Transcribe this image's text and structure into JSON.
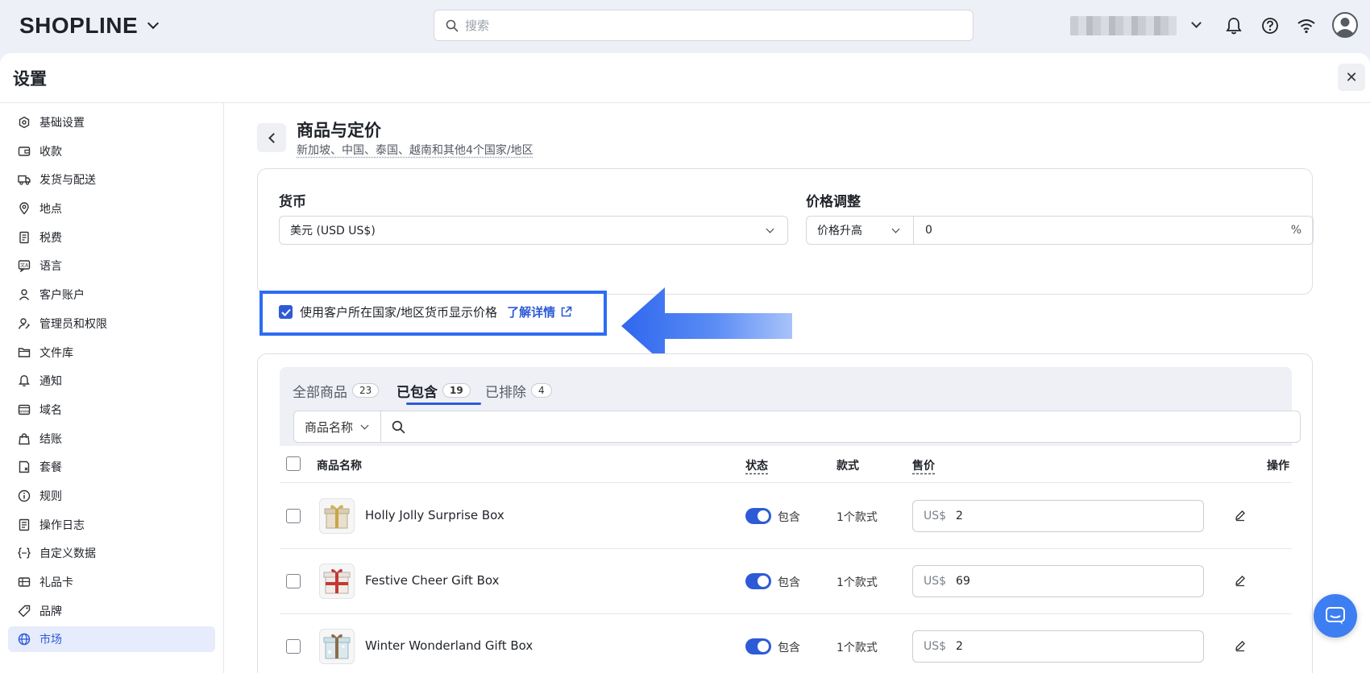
{
  "header": {
    "logo": "SHOPLINE",
    "search_placeholder": "搜索"
  },
  "panel": {
    "title": "设置",
    "close_symbol": "✕"
  },
  "sidebar": {
    "items": [
      {
        "label": "基础设置",
        "icon": "settings-icon"
      },
      {
        "label": "收款",
        "icon": "payment-icon"
      },
      {
        "label": "发货与配送",
        "icon": "truck-icon"
      },
      {
        "label": "地点",
        "icon": "location-icon"
      },
      {
        "label": "税费",
        "icon": "tax-icon"
      },
      {
        "label": "语言",
        "icon": "language-icon"
      },
      {
        "label": "客户账户",
        "icon": "user-icon"
      },
      {
        "label": "管理员和权限",
        "icon": "admin-icon"
      },
      {
        "label": "文件库",
        "icon": "folder-icon"
      },
      {
        "label": "通知",
        "icon": "bell-icon"
      },
      {
        "label": "域名",
        "icon": "domain-icon"
      },
      {
        "label": "结账",
        "icon": "bag-icon"
      },
      {
        "label": "套餐",
        "icon": "plan-icon"
      },
      {
        "label": "规则",
        "icon": "info-icon"
      },
      {
        "label": "操作日志",
        "icon": "log-icon"
      },
      {
        "label": "自定义数据",
        "icon": "code-icon"
      },
      {
        "label": "礼品卡",
        "icon": "giftcard-icon"
      },
      {
        "label": "品牌",
        "icon": "brand-icon"
      },
      {
        "label": "市场",
        "icon": "globe-icon",
        "active": true
      }
    ]
  },
  "page": {
    "title": "商品与定价",
    "subtitle": "新加坡、中国、泰国、越南和其他4个国家/地区"
  },
  "currency": {
    "label": "货币",
    "value": "美元 (USD US$)",
    "checkbox_label": "使用客户所在国家/地区货币显示价格",
    "learn_more": "了解详情"
  },
  "price_adjustment": {
    "label": "价格调整",
    "mode": "价格升高",
    "value": "0",
    "unit": "%"
  },
  "tabs": [
    {
      "label": "全部商品",
      "count": "23"
    },
    {
      "label": "已包含",
      "count": "19",
      "active": true
    },
    {
      "label": "已排除",
      "count": "4"
    }
  ],
  "filter": {
    "field": "商品名称"
  },
  "table": {
    "headers": {
      "name": "商品名称",
      "status": "状态",
      "variants": "款式",
      "price": "售价",
      "actions": "操作"
    },
    "rows": [
      {
        "name": "Holly Jolly Surprise Box",
        "status": "包含",
        "variants": "1个款式",
        "currency": "US$",
        "price": "2"
      },
      {
        "name": "Festive Cheer Gift Box",
        "status": "包含",
        "variants": "1个款式",
        "currency": "US$",
        "price": "69"
      },
      {
        "name": "Winter Wonderland Gift Box",
        "status": "包含",
        "variants": "1个款式",
        "currency": "US$",
        "price": "2"
      }
    ]
  },
  "colors": {
    "accent": "#2d5bd7",
    "highlight_border": "#2d6cf5",
    "arrow": "#3f74f0",
    "background": "#eef0f8"
  }
}
